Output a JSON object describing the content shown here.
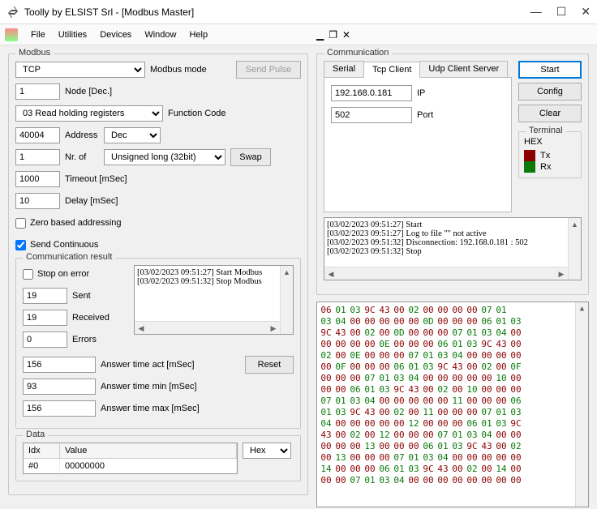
{
  "window": {
    "title": "Toolly by ELSIST Srl - [Modbus Master]"
  },
  "menu": {
    "file": "File",
    "utilities": "Utilities",
    "devices": "Devices",
    "window": "Window",
    "help": "Help"
  },
  "modbus": {
    "legend": "Modbus",
    "mode_value": "TCP",
    "mode_label": "Modbus mode",
    "send_pulse": "Send Pulse",
    "node_value": "1",
    "node_label": "Node [Dec.]",
    "func_value": "03 Read holding registers",
    "func_label": "Function Code",
    "address_value": "40004",
    "address_label": "Address",
    "addr_fmt": "Dec",
    "nrof_value": "1",
    "nrof_label": "Nr. of",
    "dtype_value": "Unsigned long (32bit)",
    "swap": "Swap",
    "timeout_value": "1000",
    "timeout_label": "Timeout [mSec]",
    "delay_value": "10",
    "delay_label": "Delay [mSec]",
    "zero_based": "Zero based addressing",
    "send_cont": "Send Continuous"
  },
  "commres": {
    "legend": "Communication result",
    "stop_on_error": "Stop on error",
    "sent_value": "19",
    "sent_label": "Sent",
    "recv_value": "19",
    "recv_label": "Received",
    "err_value": "0",
    "err_label": "Errors",
    "log1": "[03/02/2023 09:51:27] Start Modbus",
    "log2": "[03/02/2023 09:51:32] Stop Modbus",
    "act_value": "156",
    "act_label": "Answer time act [mSec]",
    "reset": "Reset",
    "min_value": "93",
    "min_label": "Answer time min [mSec]",
    "max_value": "156",
    "max_label": "Answer time max [mSec]"
  },
  "data": {
    "legend": "Data",
    "hdr_idx": "Idx",
    "hdr_value": "Value",
    "idx0": "#0",
    "val0": "00000000",
    "fmt": "Hex"
  },
  "comm": {
    "legend": "Communication",
    "tab_serial": "Serial",
    "tab_tcp": "Tcp Client",
    "tab_udp": "Udp Client Server",
    "ip_value": "192.168.0.181",
    "ip_label": "IP",
    "port_value": "502",
    "port_label": "Port",
    "start": "Start",
    "config": "Config",
    "clear": "Clear",
    "log1": "[03/02/2023 09:51:27] Start",
    "log2": "[03/02/2023 09:51:27] Log to file \"\" not active",
    "log3": "[03/02/2023 09:51:32] Disconnection: 192.168.0.181 : 502",
    "log4": "[03/02/2023 09:51:32] Stop"
  },
  "terminal": {
    "legend": "Terminal",
    "hex_label": "HEX",
    "tx": "Tx",
    "rx": "Rx"
  },
  "hex_rows": [
    [
      [
        "06",
        "r"
      ],
      [
        "01",
        "g"
      ],
      [
        "03",
        "g"
      ],
      [
        "9C",
        "r"
      ],
      [
        "43",
        "r"
      ],
      [
        "00",
        "r"
      ],
      [
        "02",
        "g"
      ],
      [
        "00",
        "r"
      ],
      [
        "00",
        "r"
      ],
      [
        "00",
        "r"
      ],
      [
        "00",
        "r"
      ],
      [
        "07",
        "g"
      ],
      [
        "01",
        "g"
      ]
    ],
    [
      [
        "03",
        "g"
      ],
      [
        "04",
        "g"
      ],
      [
        "00",
        "r"
      ],
      [
        "00",
        "r"
      ],
      [
        "00",
        "r"
      ],
      [
        "00",
        "r"
      ],
      [
        "00",
        "r"
      ],
      [
        "0D",
        "g"
      ],
      [
        "00",
        "r"
      ],
      [
        "00",
        "r"
      ],
      [
        "00",
        "r"
      ],
      [
        "06",
        "g"
      ],
      [
        "01",
        "g"
      ],
      [
        "03",
        "g"
      ]
    ],
    [
      [
        "9C",
        "r"
      ],
      [
        "43",
        "r"
      ],
      [
        "00",
        "r"
      ],
      [
        "02",
        "g"
      ],
      [
        "00",
        "r"
      ],
      [
        "0D",
        "g"
      ],
      [
        "00",
        "r"
      ],
      [
        "00",
        "r"
      ],
      [
        "00",
        "r"
      ],
      [
        "07",
        "g"
      ],
      [
        "01",
        "g"
      ],
      [
        "03",
        "g"
      ],
      [
        "04",
        "g"
      ],
      [
        "00",
        "r"
      ]
    ],
    [
      [
        "00",
        "r"
      ],
      [
        "00",
        "r"
      ],
      [
        "00",
        "r"
      ],
      [
        "00",
        "r"
      ],
      [
        "0E",
        "g"
      ],
      [
        "00",
        "r"
      ],
      [
        "00",
        "r"
      ],
      [
        "00",
        "r"
      ],
      [
        "06",
        "g"
      ],
      [
        "01",
        "g"
      ],
      [
        "03",
        "g"
      ],
      [
        "9C",
        "r"
      ],
      [
        "43",
        "r"
      ],
      [
        "00",
        "r"
      ]
    ],
    [
      [
        "02",
        "g"
      ],
      [
        "00",
        "r"
      ],
      [
        "0E",
        "g"
      ],
      [
        "00",
        "r"
      ],
      [
        "00",
        "r"
      ],
      [
        "00",
        "r"
      ],
      [
        "07",
        "g"
      ],
      [
        "01",
        "g"
      ],
      [
        "03",
        "g"
      ],
      [
        "04",
        "g"
      ],
      [
        "00",
        "r"
      ],
      [
        "00",
        "r"
      ],
      [
        "00",
        "r"
      ],
      [
        "00",
        "r"
      ]
    ],
    [
      [
        "00",
        "r"
      ],
      [
        "0F",
        "g"
      ],
      [
        "00",
        "r"
      ],
      [
        "00",
        "r"
      ],
      [
        "00",
        "r"
      ],
      [
        "06",
        "g"
      ],
      [
        "01",
        "g"
      ],
      [
        "03",
        "g"
      ],
      [
        "9C",
        "r"
      ],
      [
        "43",
        "r"
      ],
      [
        "00",
        "r"
      ],
      [
        "02",
        "g"
      ],
      [
        "00",
        "r"
      ],
      [
        "0F",
        "g"
      ]
    ],
    [
      [
        "00",
        "r"
      ],
      [
        "00",
        "r"
      ],
      [
        "00",
        "r"
      ],
      [
        "07",
        "g"
      ],
      [
        "01",
        "g"
      ],
      [
        "03",
        "g"
      ],
      [
        "04",
        "g"
      ],
      [
        "00",
        "r"
      ],
      [
        "00",
        "r"
      ],
      [
        "00",
        "r"
      ],
      [
        "00",
        "r"
      ],
      [
        "00",
        "r"
      ],
      [
        "10",
        "g"
      ],
      [
        "00",
        "r"
      ]
    ],
    [
      [
        "00",
        "r"
      ],
      [
        "00",
        "r"
      ],
      [
        "06",
        "g"
      ],
      [
        "01",
        "g"
      ],
      [
        "03",
        "g"
      ],
      [
        "9C",
        "r"
      ],
      [
        "43",
        "r"
      ],
      [
        "00",
        "r"
      ],
      [
        "02",
        "g"
      ],
      [
        "00",
        "r"
      ],
      [
        "10",
        "g"
      ],
      [
        "00",
        "r"
      ],
      [
        "00",
        "r"
      ],
      [
        "00",
        "r"
      ]
    ],
    [
      [
        "07",
        "g"
      ],
      [
        "01",
        "g"
      ],
      [
        "03",
        "g"
      ],
      [
        "04",
        "g"
      ],
      [
        "00",
        "r"
      ],
      [
        "00",
        "r"
      ],
      [
        "00",
        "r"
      ],
      [
        "00",
        "r"
      ],
      [
        "00",
        "r"
      ],
      [
        "11",
        "g"
      ],
      [
        "00",
        "r"
      ],
      [
        "00",
        "r"
      ],
      [
        "00",
        "r"
      ],
      [
        "06",
        "g"
      ]
    ],
    [
      [
        "01",
        "g"
      ],
      [
        "03",
        "g"
      ],
      [
        "9C",
        "r"
      ],
      [
        "43",
        "r"
      ],
      [
        "00",
        "r"
      ],
      [
        "02",
        "g"
      ],
      [
        "00",
        "r"
      ],
      [
        "11",
        "g"
      ],
      [
        "00",
        "r"
      ],
      [
        "00",
        "r"
      ],
      [
        "00",
        "r"
      ],
      [
        "07",
        "g"
      ],
      [
        "01",
        "g"
      ],
      [
        "03",
        "g"
      ]
    ],
    [
      [
        "04",
        "g"
      ],
      [
        "00",
        "r"
      ],
      [
        "00",
        "r"
      ],
      [
        "00",
        "r"
      ],
      [
        "00",
        "r"
      ],
      [
        "00",
        "r"
      ],
      [
        "12",
        "g"
      ],
      [
        "00",
        "r"
      ],
      [
        "00",
        "r"
      ],
      [
        "00",
        "r"
      ],
      [
        "06",
        "g"
      ],
      [
        "01",
        "g"
      ],
      [
        "03",
        "g"
      ],
      [
        "9C",
        "r"
      ]
    ],
    [
      [
        "43",
        "r"
      ],
      [
        "00",
        "r"
      ],
      [
        "02",
        "g"
      ],
      [
        "00",
        "r"
      ],
      [
        "12",
        "g"
      ],
      [
        "00",
        "r"
      ],
      [
        "00",
        "r"
      ],
      [
        "00",
        "r"
      ],
      [
        "07",
        "g"
      ],
      [
        "01",
        "g"
      ],
      [
        "03",
        "g"
      ],
      [
        "04",
        "g"
      ],
      [
        "00",
        "r"
      ],
      [
        "00",
        "r"
      ]
    ],
    [
      [
        "00",
        "r"
      ],
      [
        "00",
        "r"
      ],
      [
        "00",
        "r"
      ],
      [
        "13",
        "g"
      ],
      [
        "00",
        "r"
      ],
      [
        "00",
        "r"
      ],
      [
        "00",
        "r"
      ],
      [
        "06",
        "g"
      ],
      [
        "01",
        "g"
      ],
      [
        "03",
        "g"
      ],
      [
        "9C",
        "r"
      ],
      [
        "43",
        "r"
      ],
      [
        "00",
        "r"
      ],
      [
        "02",
        "g"
      ]
    ],
    [
      [
        "00",
        "r"
      ],
      [
        "13",
        "g"
      ],
      [
        "00",
        "r"
      ],
      [
        "00",
        "r"
      ],
      [
        "00",
        "r"
      ],
      [
        "07",
        "g"
      ],
      [
        "01",
        "g"
      ],
      [
        "03",
        "g"
      ],
      [
        "04",
        "g"
      ],
      [
        "00",
        "r"
      ],
      [
        "00",
        "r"
      ],
      [
        "00",
        "r"
      ],
      [
        "00",
        "r"
      ],
      [
        "00",
        "r"
      ]
    ],
    [
      [
        "14",
        "g"
      ],
      [
        "00",
        "r"
      ],
      [
        "00",
        "r"
      ],
      [
        "00",
        "r"
      ],
      [
        "06",
        "g"
      ],
      [
        "01",
        "g"
      ],
      [
        "03",
        "g"
      ],
      [
        "9C",
        "r"
      ],
      [
        "43",
        "r"
      ],
      [
        "00",
        "r"
      ],
      [
        "02",
        "g"
      ],
      [
        "00",
        "r"
      ],
      [
        "14",
        "g"
      ],
      [
        "00",
        "r"
      ]
    ],
    [
      [
        "00",
        "r"
      ],
      [
        "00",
        "r"
      ],
      [
        "07",
        "g"
      ],
      [
        "01",
        "g"
      ],
      [
        "03",
        "g"
      ],
      [
        "04",
        "g"
      ],
      [
        "00",
        "r"
      ],
      [
        "00",
        "r"
      ],
      [
        "00",
        "r"
      ],
      [
        "00",
        "r"
      ],
      [
        "00",
        "r"
      ],
      [
        "00",
        "r"
      ],
      [
        "00",
        "r"
      ],
      [
        "00",
        "r"
      ]
    ]
  ]
}
